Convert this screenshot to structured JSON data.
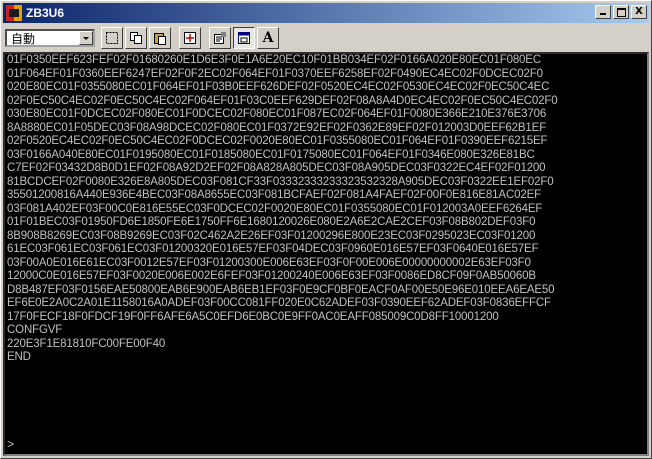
{
  "window": {
    "title": "ZB3U6"
  },
  "titlebar_buttons": {
    "minimize": "_",
    "maximize": "□",
    "close": "X"
  },
  "toolbar": {
    "mode_select": {
      "value": "自動"
    },
    "font_button": "A"
  },
  "console": {
    "lines": [
      "01F0350EEF623FEF02F01680260E1D6E3F0E1A6E20EC10F01BB034EF02F0166A020E80EC01F080EC",
      "01F064EF01F0360EEF6247EF02F0F2EC02F064EF01F0370EEF6258EF02F0490EC4EC02F0DCEC02F0",
      "020E80EC01F0355080EC01F064EF01F03B0EEF626DEF02F0520EC4EC02F0530EC4EC02F0EC50C4EC",
      "02F0EC50C4EC02F0EC50C4EC02F064EF01F03C0EEF629DEF02F08A8A4D0EC4EC02F0EC50C4EC02F0",
      "030E80EC01F0DCEC02F080EC01F0DCEC02F080EC01F087EC02F064EF01F0080E366E210E376E3706",
      "8A8880EC01F05DEC03F08A98DCEC02F080EC01F0372E92EF02F0362E89EF02F012003D0EEF62B1EF",
      "02F0520EC4EC02F0EC50C4EC02F0DCEC02F0020E80EC01F0355080EC01F064EF01F0390EEF6215EF",
      "03F0166A040E80EC01F0195080EC01F0185080EC01F0175080EC01F064EF01F0346E080E326E81BC",
      "C7EF02F03432D8B0D1EF02F08A92D2EF02F08A828A805DEC03F08A905DEC03F0322EC4EF02F01200",
      "81BCDCEF02F0080E326E8A805DEC03F081CF33F03332333233323532328A905DEC03F0322EE1EF02F0",
      "35501200816A440E936E4BEC03F08A8655EC03F081BCFAEF02F081A4FAEF02F00F0E816E81AC02EF",
      "03F081A402EF03F00C0E816E55EC03F0DCEC02F0020E80EC01F0355080EC01F012003A0EEF6264EF",
      "01F01BEC03F01950FD6E1850FE6E1750FF6E1680120026E080E2A6E2CAE2CEF03F08B802DEF03F0",
      "8B908B8269EC03F08B9269EC03F02C462A2E26EF03F01200296E800E23EC03F0295023EC03F01200",
      "61EC03F061EC03F061EC03F01200320E016E57EF03F04DEC03F0960E016E57EF03F0640E016E57EF",
      "03F00A0E016E61EC03F0012E57EF03F01200300E006E63EF03F0F00E006E00000000002E63EF03F0",
      "12000C0E016E57EF03F0020E006E002E6FEF03F01200240E006E63EF03F0086ED8CF09F0AB50060B",
      "D8B487EF03F0156EAE50800EAB6E900EAB6EB1EF03F0E9CF0BF0EACF0AF00E50E96E010EEA6EAE50",
      "EF6E0E2A0C2A01E1158016A0ADEF03F00CC081FF020E0C62ADEF03F0390EEF62ADEF03F0836EFFCF",
      "17F0FECF18F0FDCF19F0FF6AFE6A5C0EFD6E0BC0E9FF0AC0EAFF085009C0D8FF10001200",
      "CONFGVF",
      "220E3F1E81810FC00FE00F40",
      "END"
    ],
    "prompt": ">"
  }
}
